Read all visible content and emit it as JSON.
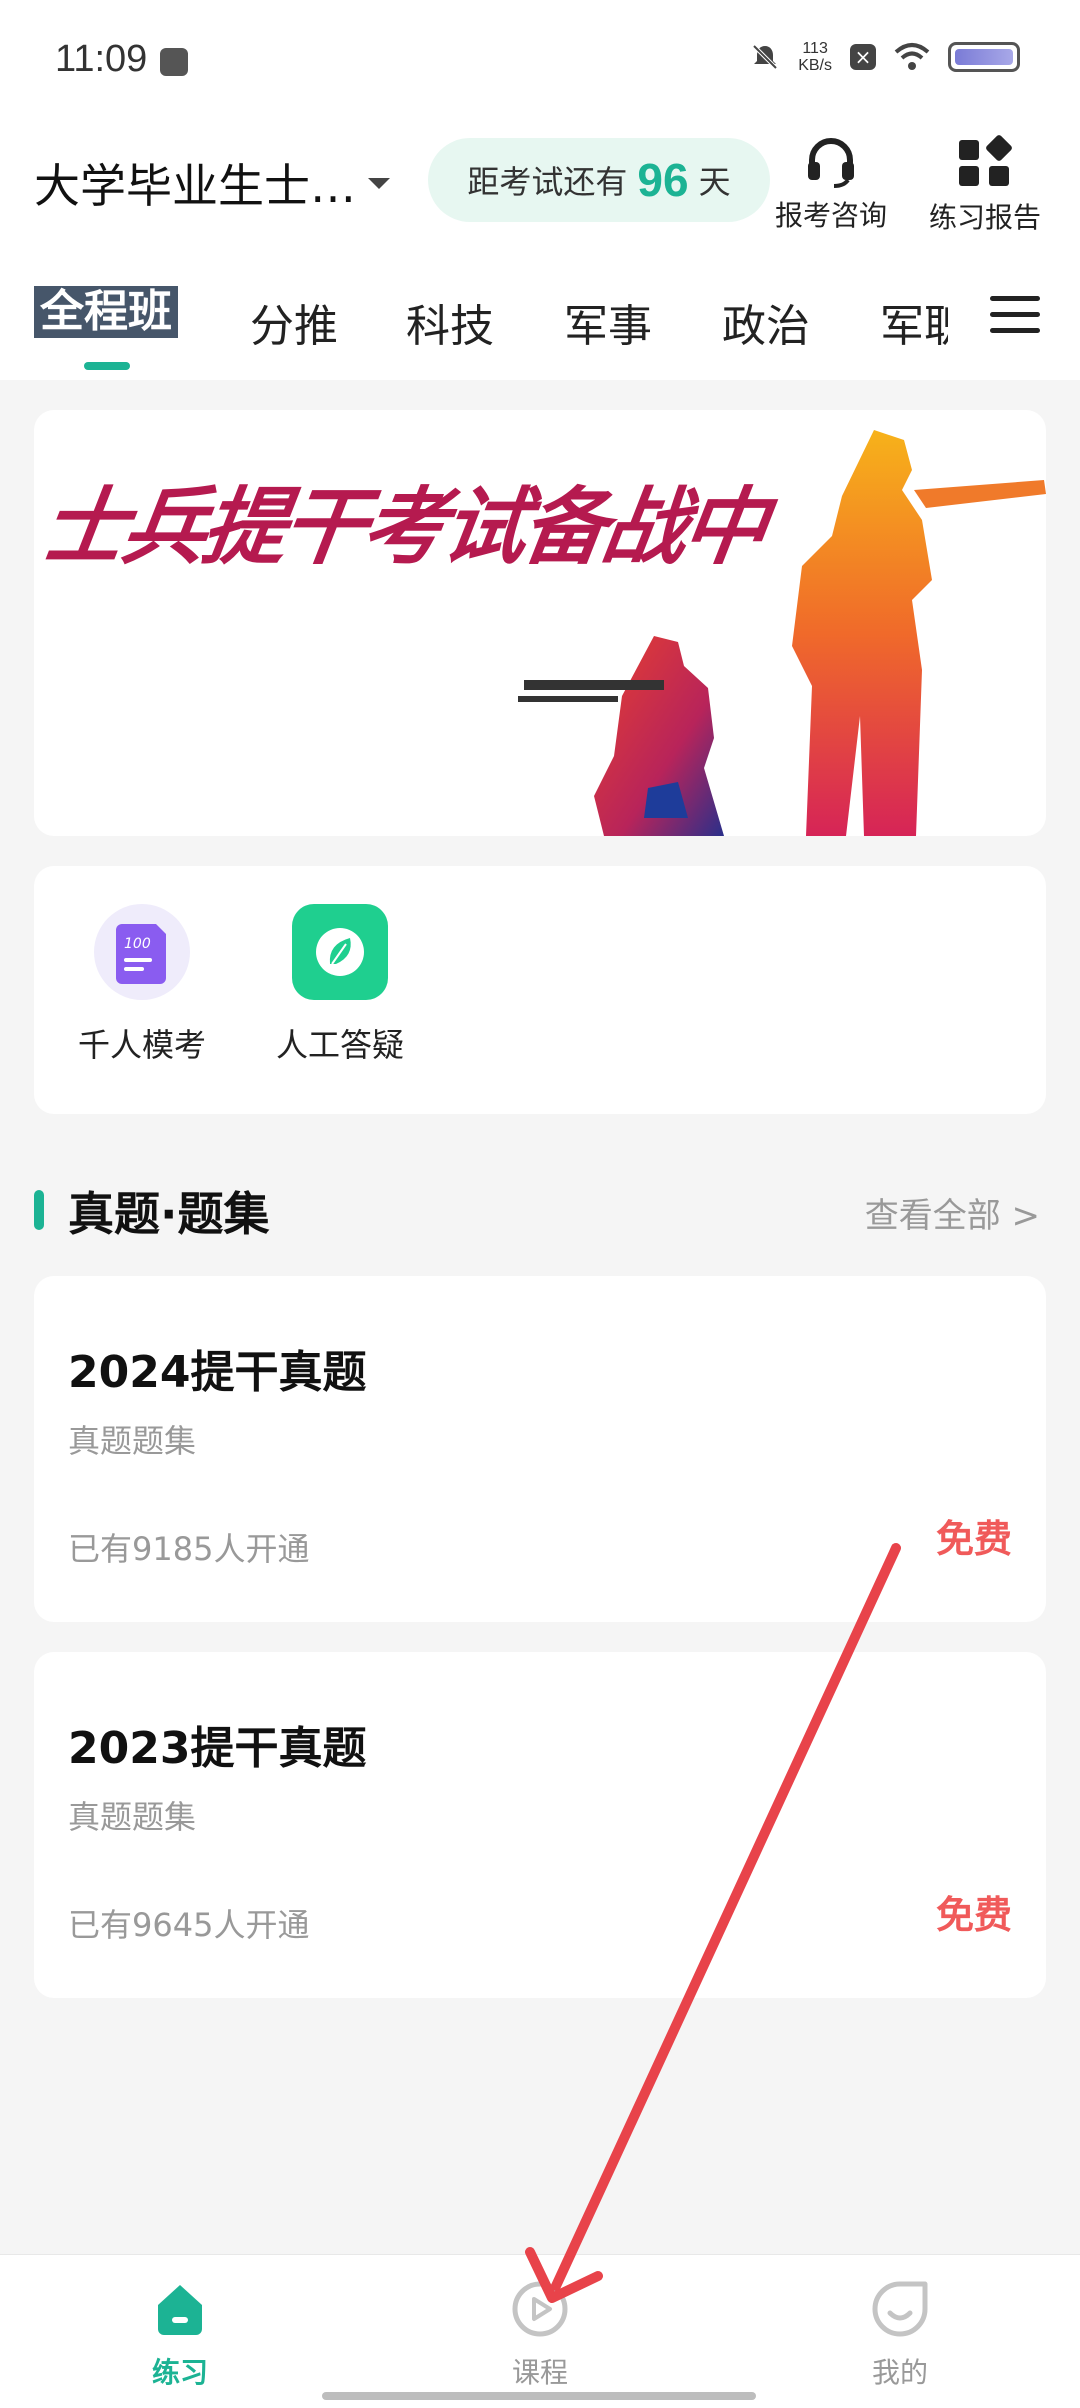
{
  "status_bar": {
    "time": "11:09",
    "net_speed_value": "113",
    "net_speed_unit": "KB/s"
  },
  "header": {
    "exam_name": "大学毕业生士…",
    "countdown_prefix": "距考试还有",
    "countdown_days": "96",
    "countdown_suffix": "天",
    "consult_label": "报考咨询",
    "report_label": "练习报告"
  },
  "tabs": [
    {
      "label": "全程班",
      "active": true
    },
    {
      "label": "分推"
    },
    {
      "label": "科技"
    },
    {
      "label": "军事"
    },
    {
      "label": "政治"
    },
    {
      "label": "军职"
    }
  ],
  "banner": {
    "text": "士兵提干考试备战中"
  },
  "tools": [
    {
      "label": "千人模考",
      "icon": "mock-exam-icon",
      "badge": "100"
    },
    {
      "label": "人工答疑",
      "icon": "leaf-qa-icon"
    }
  ],
  "section": {
    "title": "真题·题集",
    "more_label": "查看全部 >"
  },
  "cards": [
    {
      "title": "2024提干真题",
      "subtitle": "真题题集",
      "count": "已有9185人开通",
      "price": "免费"
    },
    {
      "title": "2023提干真题",
      "subtitle": "真题题集",
      "count": "已有9645人开通",
      "price": "免费"
    }
  ],
  "bottom_nav": [
    {
      "label": "练习",
      "icon": "home-icon",
      "active": true
    },
    {
      "label": "课程",
      "icon": "play-circle-icon"
    },
    {
      "label": "我的",
      "icon": "profile-face-icon"
    }
  ],
  "colors": {
    "accent": "#1cb394",
    "price": "#f05a5a",
    "annotation_arrow": "#e8434a"
  }
}
